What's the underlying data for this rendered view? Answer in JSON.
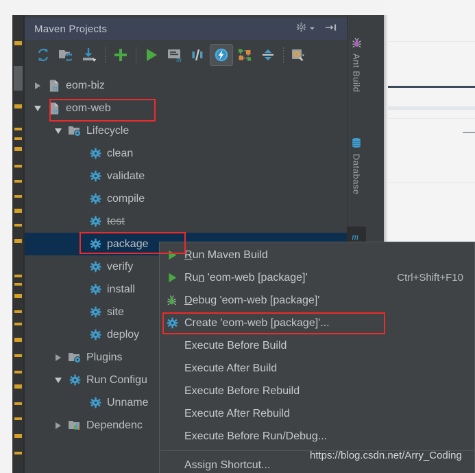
{
  "window": {
    "tool_title": "Maven Projects",
    "header_icons": [
      {
        "name": "gear-icon",
        "label": "Settings"
      },
      {
        "name": "chevron-down-icon",
        "label": "Dropdown"
      },
      {
        "name": "hide-panel-icon",
        "label": "Hide"
      }
    ]
  },
  "toolbar": {
    "buttons": [
      {
        "name": "reimport-icon",
        "label": "Reimport All Maven Projects",
        "active": false
      },
      {
        "name": "generate-sources-icon",
        "label": "Generate Sources and Update Folders",
        "active": false
      },
      {
        "name": "download-sources-icon",
        "label": "Download Sources and/or Documentation",
        "active": false
      },
      {
        "name": "add-maven-project-icon",
        "label": "Add Maven Projects",
        "active": false
      },
      {
        "name": "run-icon",
        "label": "Execute Maven Goal",
        "active": false
      },
      {
        "name": "maven-settings-icon",
        "label": "Maven Settings",
        "active": false
      },
      {
        "name": "toggle-skip-tests-icon",
        "label": "Toggle 'Skip Tests' Mode",
        "active": false
      },
      {
        "name": "toggle-offline-icon",
        "label": "Toggle Offline Mode",
        "active": true
      },
      {
        "name": "show-dependencies-icon",
        "label": "Show Dependencies",
        "active": false
      },
      {
        "name": "collapse-all-icon",
        "label": "Collapse All",
        "active": false
      },
      {
        "name": "settings-icon",
        "label": "Settings",
        "active": false
      }
    ]
  },
  "tree": {
    "rows": [
      {
        "indent": 0,
        "twisty": "right",
        "icon": "maven-module-icon",
        "label": "eom-biz",
        "selected": false,
        "strike": false
      },
      {
        "indent": 0,
        "twisty": "down",
        "icon": "maven-module-icon",
        "label": "eom-web",
        "selected": false,
        "strike": false
      },
      {
        "indent": 1,
        "twisty": "down",
        "icon": "lifecycle-folder-icon",
        "label": "Lifecycle",
        "selected": false,
        "strike": false
      },
      {
        "indent": 2,
        "twisty": "none",
        "icon": "goal-gear-icon",
        "label": "clean",
        "selected": false,
        "strike": false
      },
      {
        "indent": 2,
        "twisty": "none",
        "icon": "goal-gear-icon",
        "label": "validate",
        "selected": false,
        "strike": false
      },
      {
        "indent": 2,
        "twisty": "none",
        "icon": "goal-gear-icon",
        "label": "compile",
        "selected": false,
        "strike": false
      },
      {
        "indent": 2,
        "twisty": "none",
        "icon": "goal-gear-icon",
        "label": "test",
        "selected": false,
        "strike": true
      },
      {
        "indent": 2,
        "twisty": "none",
        "icon": "goal-gear-icon",
        "label": "package",
        "selected": true,
        "strike": false
      },
      {
        "indent": 2,
        "twisty": "none",
        "icon": "goal-gear-icon",
        "label": "verify",
        "selected": false,
        "strike": false
      },
      {
        "indent": 2,
        "twisty": "none",
        "icon": "goal-gear-icon",
        "label": "install",
        "selected": false,
        "strike": false
      },
      {
        "indent": 2,
        "twisty": "none",
        "icon": "goal-gear-icon",
        "label": "site",
        "selected": false,
        "strike": false
      },
      {
        "indent": 2,
        "twisty": "none",
        "icon": "goal-gear-icon",
        "label": "deploy",
        "selected": false,
        "strike": false
      },
      {
        "indent": 1,
        "twisty": "right",
        "icon": "plugins-folder-icon",
        "label": "Plugins",
        "selected": false,
        "strike": false
      },
      {
        "indent": 1,
        "twisty": "down",
        "icon": "run-config-gear-icon",
        "label": "Run Configu",
        "selected": false,
        "strike": false
      },
      {
        "indent": 2,
        "twisty": "none",
        "icon": "goal-gear-icon",
        "label": "Unname",
        "selected": false,
        "strike": false
      },
      {
        "indent": 1,
        "twisty": "right",
        "icon": "dependencies-folder-icon",
        "label": "Dependenc",
        "selected": false,
        "strike": false
      }
    ]
  },
  "side_tabs": [
    {
      "name": "tab-ant-build",
      "label": "Ant Build",
      "icon": "ant-icon",
      "active": false
    },
    {
      "name": "tab-database",
      "label": "Database",
      "icon": "database-icon",
      "active": false
    },
    {
      "name": "tab-maven-projects",
      "label": "M",
      "icon": "maven-m-icon",
      "active": true
    }
  ],
  "context_menu": {
    "items": [
      {
        "name": "menu-run-maven-build",
        "icon": "run-green-icon",
        "label": "Run Maven Build",
        "mnemonic": "R",
        "shortcut": "",
        "separator_before": false
      },
      {
        "name": "menu-run-eom-web-package",
        "icon": "run-green-icon",
        "label": "Run 'eom-web [package]'",
        "mnemonic": "n",
        "shortcut": "Ctrl+Shift+F10",
        "separator_before": false
      },
      {
        "name": "menu-debug-eom-web-package",
        "icon": "debug-bug-icon",
        "label": "Debug 'eom-web [package]'",
        "mnemonic": "D",
        "shortcut": "",
        "separator_before": false
      },
      {
        "name": "menu-create-eom-web-package",
        "icon": "goal-gear-icon",
        "label": "Create 'eom-web [package]'...",
        "mnemonic": "",
        "shortcut": "",
        "separator_before": false
      },
      {
        "name": "menu-execute-before-build",
        "icon": "",
        "label": "Execute Before Build",
        "mnemonic": "",
        "shortcut": "",
        "separator_before": false
      },
      {
        "name": "menu-execute-after-build",
        "icon": "",
        "label": "Execute After Build",
        "mnemonic": "",
        "shortcut": "",
        "separator_before": false
      },
      {
        "name": "menu-execute-before-rebuild",
        "icon": "",
        "label": "Execute Before Rebuild",
        "mnemonic": "",
        "shortcut": "",
        "separator_before": false
      },
      {
        "name": "menu-execute-after-rebuild",
        "icon": "",
        "label": "Execute After Rebuild",
        "mnemonic": "",
        "shortcut": "",
        "separator_before": false
      },
      {
        "name": "menu-execute-before-run-debug",
        "icon": "",
        "label": "Execute Before Run/Debug...",
        "mnemonic": "",
        "shortcut": "",
        "separator_before": false
      },
      {
        "name": "menu-assign-shortcut",
        "icon": "",
        "label": "Assign Shortcut...",
        "mnemonic": "",
        "shortcut": "",
        "separator_before": true
      }
    ]
  },
  "watermark": {
    "text": "https://blog.csdn.net/Arry_Coding"
  },
  "colors": {
    "panel_bg": "#3c3f41",
    "header_bg": "#3c4456",
    "selection_bg": "#0d2f4f",
    "menu_bg": "#3f4345",
    "accent_blue": "#3592c4",
    "accent_green": "#49a942",
    "annotation_red": "#ef2a2a",
    "text": "#bcc0c2"
  }
}
